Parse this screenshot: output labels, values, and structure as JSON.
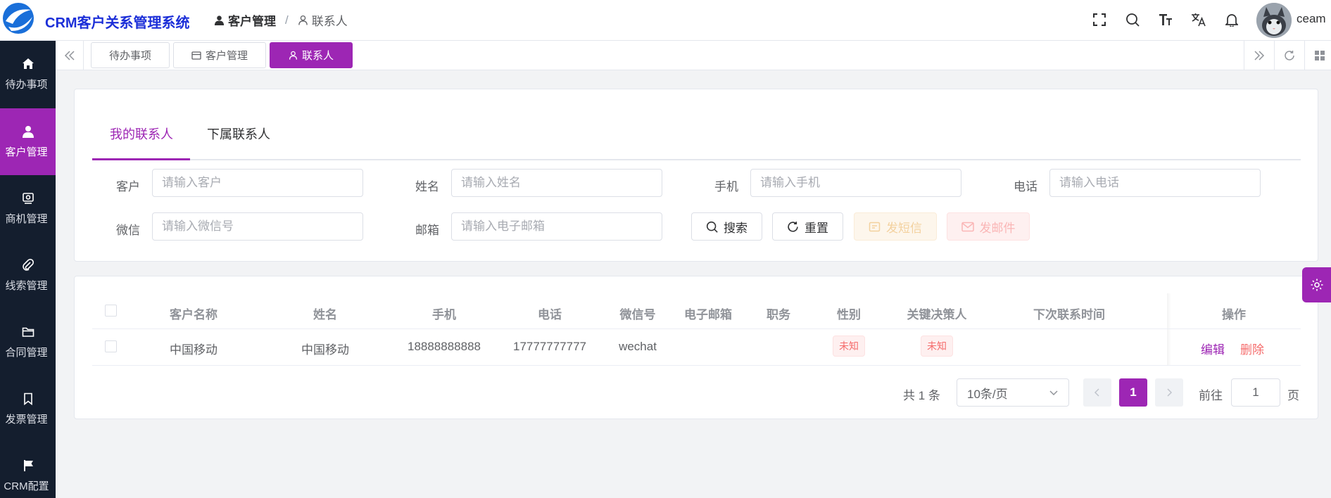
{
  "header": {
    "app_title": "CRM客户关系管理系统",
    "breadcrumb": [
      "客户管理",
      "联系人"
    ],
    "breadcrumb_separator": "/",
    "username": "ceam",
    "icons": [
      "fullscreen-icon",
      "search-icon",
      "font-size-icon",
      "translate-icon",
      "bell-icon"
    ]
  },
  "sidebar": {
    "items": [
      {
        "label": "待办事项",
        "icon": "home-icon",
        "active": false
      },
      {
        "label": "客户管理",
        "icon": "user-icon",
        "active": true
      },
      {
        "label": "商机管理",
        "icon": "opportunity-icon",
        "active": false
      },
      {
        "label": "线索管理",
        "icon": "paperclip-icon",
        "active": false
      },
      {
        "label": "合同管理",
        "icon": "folder-icon",
        "active": false
      },
      {
        "label": "发票管理",
        "icon": "bookmark-icon",
        "active": false
      },
      {
        "label": "CRM配置",
        "icon": "flag-icon",
        "active": false
      }
    ]
  },
  "tabs": [
    {
      "label": "待办事项",
      "icon": "",
      "active": false
    },
    {
      "label": "客户管理",
      "icon": "card-icon",
      "active": false
    },
    {
      "label": "联系人",
      "icon": "user-icon",
      "active": true
    }
  ],
  "inner_tabs": [
    "我的联系人",
    "下属联系人"
  ],
  "search": {
    "customer": {
      "label": "客户",
      "placeholder": "请输入客户",
      "value": ""
    },
    "name": {
      "label": "姓名",
      "placeholder": "请输入姓名",
      "value": ""
    },
    "mobile": {
      "label": "手机",
      "placeholder": "请输入手机",
      "value": ""
    },
    "phone": {
      "label": "电话",
      "placeholder": "请输入电话",
      "value": ""
    },
    "wechat": {
      "label": "微信",
      "placeholder": "请输入微信号",
      "value": ""
    },
    "email": {
      "label": "邮箱",
      "placeholder": "请输入电子邮箱",
      "value": ""
    },
    "buttons": {
      "search": "搜索",
      "reset": "重置",
      "sms": "发短信",
      "mail": "发邮件"
    }
  },
  "table": {
    "columns": [
      "客户名称",
      "姓名",
      "手机",
      "电话",
      "微信号",
      "电子邮箱",
      "职务",
      "性别",
      "关键决策人",
      "下次联系时间",
      "操作"
    ],
    "rows": [
      {
        "customer": "中国移动",
        "name": "中国移动",
        "mobile": "18888888888",
        "phone": "17777777777",
        "wechat": "wechat",
        "email": "",
        "position": "",
        "gender": "未知",
        "decision_maker": "未知",
        "next_contact": "",
        "actions": [
          "编辑",
          "删除"
        ]
      }
    ]
  },
  "pagination": {
    "total_text": "共 1 条",
    "page_size": "10条/页",
    "current_page": "1",
    "goto_label": "前往",
    "goto_value": "1",
    "page_suffix": "页"
  },
  "colors": {
    "primary": "#9d26b4",
    "sidebar_bg": "#141e2e",
    "title_blue": "#1c2fd8",
    "danger": "#f56c6c"
  }
}
